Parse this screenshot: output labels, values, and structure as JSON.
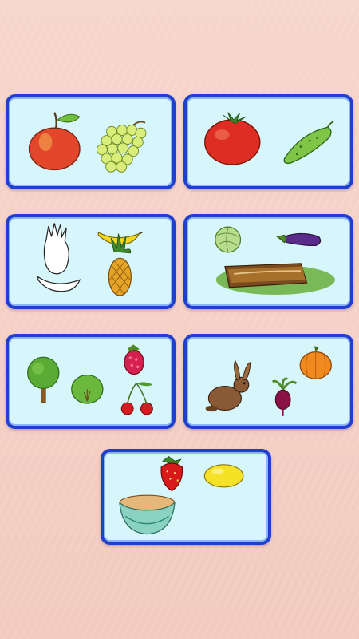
{
  "game": {
    "cards": [
      {
        "id": 1,
        "items": [
          "apple-icon",
          "grapes-icon"
        ]
      },
      {
        "id": 2,
        "items": [
          "tomato-icon",
          "cucumber-icon"
        ]
      },
      {
        "id": 3,
        "items": [
          "pineapple-outline-icon",
          "banana-icon",
          "banana-outline-icon",
          "pineapple-icon"
        ]
      },
      {
        "id": 4,
        "items": [
          "cabbage-icon",
          "eggplant-icon",
          "garden-bed-icon"
        ]
      },
      {
        "id": 5,
        "items": [
          "tree-icon",
          "bush-icon",
          "raspberry-icon",
          "cherries-icon"
        ]
      },
      {
        "id": 6,
        "items": [
          "rabbit-icon",
          "pumpkin-icon",
          "beetroot-icon"
        ]
      },
      {
        "id": 7,
        "items": [
          "strawberry-icon",
          "lemon-icon",
          "bowl-icon"
        ]
      }
    ],
    "colors": {
      "card_fill": "#d6f6fb",
      "card_border": "#1f3fcf",
      "background": "#f4d0c8"
    }
  }
}
